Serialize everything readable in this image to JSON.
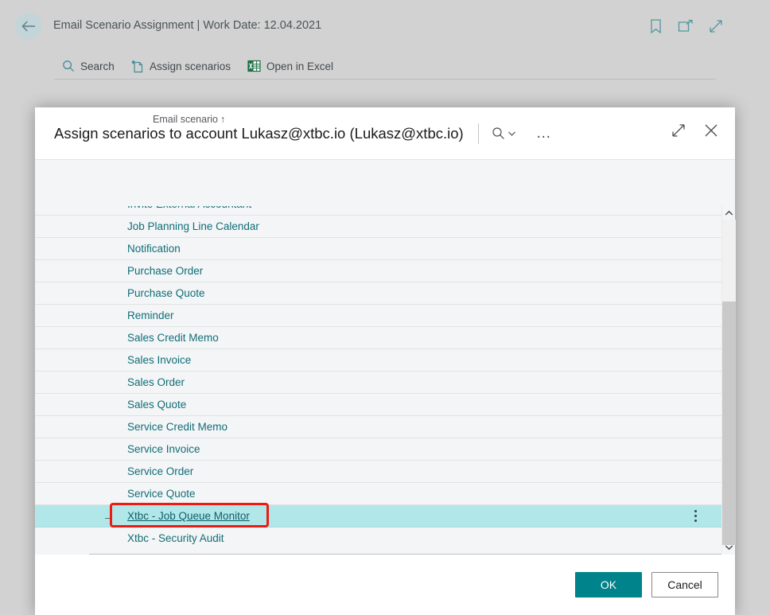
{
  "window": {
    "title": "Email Scenario Assignment | Work Date: 12.04.2021",
    "back_icon": "back-arrow-icon",
    "icons": [
      {
        "name": "bookmark-icon",
        "label": "Bookmark"
      },
      {
        "name": "open-in-new-window-icon",
        "label": "Open in new window"
      },
      {
        "name": "expand-icon",
        "label": "Expand"
      }
    ]
  },
  "actionbar": {
    "items": [
      {
        "name": "search",
        "label": "Search",
        "icon": "search-icon"
      },
      {
        "name": "assign-scenarios",
        "label": "Assign scenarios",
        "icon": "new-document-icon"
      },
      {
        "name": "open-in-excel",
        "label": "Open in Excel",
        "icon": "excel-icon"
      }
    ],
    "filter_icon": "filter-icon"
  },
  "dialog": {
    "title": "Assign scenarios to account Lukasz@xtbc.io (Lukasz@xtbc.io)",
    "header_icons": [
      {
        "name": "search-icon",
        "label": "Search"
      },
      {
        "name": "chevron-down-icon",
        "label": "More search options"
      },
      {
        "name": "more-options-icon",
        "label": "…"
      }
    ],
    "right_icons": [
      {
        "name": "expand-icon",
        "label": "Maximize"
      },
      {
        "name": "close-icon",
        "label": "Close"
      }
    ],
    "column_header": "Email scenario",
    "sort_indicator": "↑",
    "rows": [
      {
        "label": "Invite External Accountant",
        "selected": false,
        "clipped": true
      },
      {
        "label": "Job Planning Line Calendar",
        "selected": false
      },
      {
        "label": "Notification",
        "selected": false
      },
      {
        "label": "Purchase Order",
        "selected": false
      },
      {
        "label": "Purchase Quote",
        "selected": false
      },
      {
        "label": "Reminder",
        "selected": false
      },
      {
        "label": "Sales Credit Memo",
        "selected": false
      },
      {
        "label": "Sales Invoice",
        "selected": false
      },
      {
        "label": "Sales Order",
        "selected": false
      },
      {
        "label": "Sales Quote",
        "selected": false
      },
      {
        "label": "Service Credit Memo",
        "selected": false
      },
      {
        "label": "Service Invoice",
        "selected": false
      },
      {
        "label": "Service Order",
        "selected": false
      },
      {
        "label": "Service Quote",
        "selected": false
      },
      {
        "label": "Xtbc - Job Queue Monitor",
        "selected": true
      },
      {
        "label": "Xtbc - Security Audit",
        "selected": false
      }
    ],
    "selected_row_arrow": "→",
    "row_menu_icon": "vertical-ellipsis-icon",
    "scrollbar": {
      "up_icon": "chevron-up-icon",
      "down_icon": "chevron-down-icon"
    },
    "footer": {
      "ok_label": "OK",
      "cancel_label": "Cancel"
    }
  },
  "annotation": {
    "type": "highlight-box",
    "target": "Xtbc - Job Queue Monitor",
    "color": "#ef1b11"
  },
  "colors": {
    "accent_teal": "#00838a",
    "link_teal": "#0f6e76",
    "selected_row": "#b2e7ea",
    "window_chrome": "#d2d2d2",
    "list_background": "#f4f5f7",
    "annotation_red": "#ef1b11"
  }
}
